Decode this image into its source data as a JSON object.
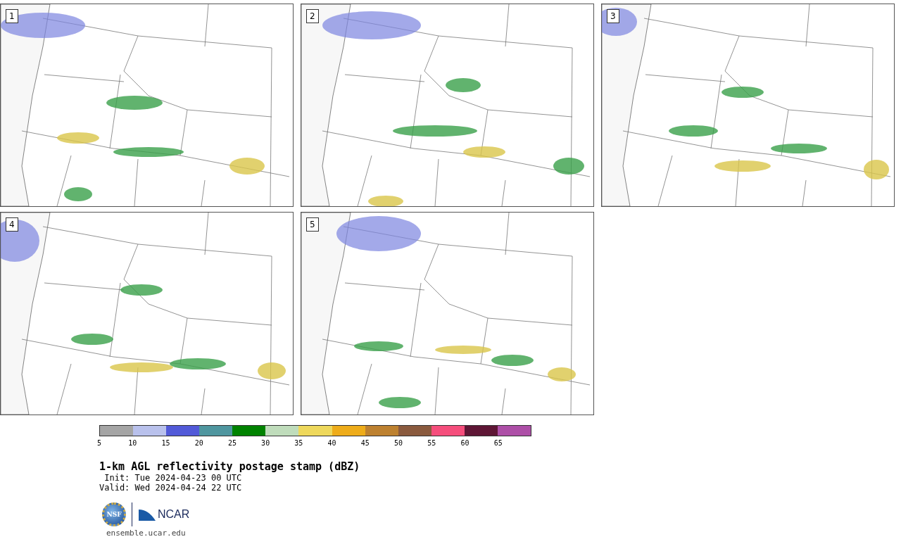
{
  "panels": [
    {
      "label": "1"
    },
    {
      "label": "2"
    },
    {
      "label": "3"
    },
    {
      "label": "4"
    },
    {
      "label": "5"
    }
  ],
  "colorbar": {
    "segments": [
      {
        "color": "#a5a5a5"
      },
      {
        "color": "#b9c1ec"
      },
      {
        "color": "#525ad8"
      },
      {
        "color": "#4f969f"
      },
      {
        "color": "#008200"
      },
      {
        "color": "#bfdcbb"
      },
      {
        "color": "#eed85c"
      },
      {
        "color": "#eeac1a"
      },
      {
        "color": "#bd8130"
      },
      {
        "color": "#8a5a3e"
      },
      {
        "color": "#f54e7c"
      },
      {
        "color": "#5e1635"
      },
      {
        "color": "#ad4fa7"
      }
    ],
    "ticks": [
      "5",
      "10",
      "15",
      "20",
      "25",
      "30",
      "35",
      "40",
      "45",
      "50",
      "55",
      "60",
      "65"
    ]
  },
  "title": "1-km AGL reflectivity postage stamp (dBZ)",
  "init": " Init: Tue 2024-04-23 00 UTC",
  "valid": "Valid: Wed 2024-04-24 22 UTC",
  "logos": {
    "nsf": "NSF",
    "ncar": "NCAR"
  },
  "footer": "ensemble.ucar.edu"
}
